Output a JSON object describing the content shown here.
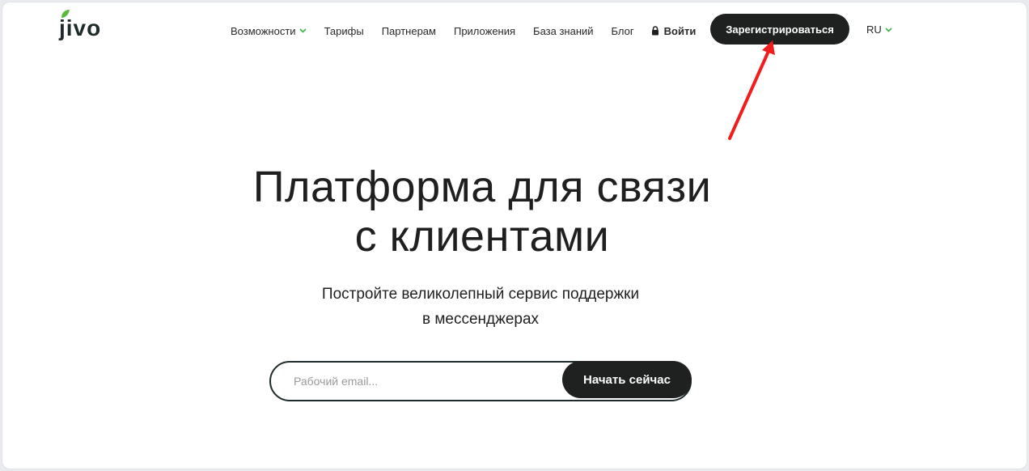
{
  "brand": {
    "logo_text": "jivo",
    "leaf_color": "#5bb93a",
    "text_color": "#1f2a2a"
  },
  "nav": {
    "items": [
      {
        "label": "Возможности",
        "has_dropdown": true
      },
      {
        "label": "Тарифы"
      },
      {
        "label": "Партнерам"
      },
      {
        "label": "Приложения"
      },
      {
        "label": "База знаний"
      },
      {
        "label": "Блог"
      }
    ],
    "login_label": "Войти",
    "register_label": "Зарегистрироваться",
    "language": "RU",
    "chevron_color": "#3bb54a"
  },
  "hero": {
    "title_line1": "Платформа для связи",
    "title_line2": "с клиентами",
    "subtitle_line1": "Постройте великолепный сервис поддержки",
    "subtitle_line2": "в мессенджерах"
  },
  "signup": {
    "email_placeholder": "Рабочий email...",
    "email_value": "",
    "cta_label": "Начать сейчас"
  },
  "annotation": {
    "type": "arrow",
    "color": "#f21c1c",
    "points_to": "register-button"
  }
}
